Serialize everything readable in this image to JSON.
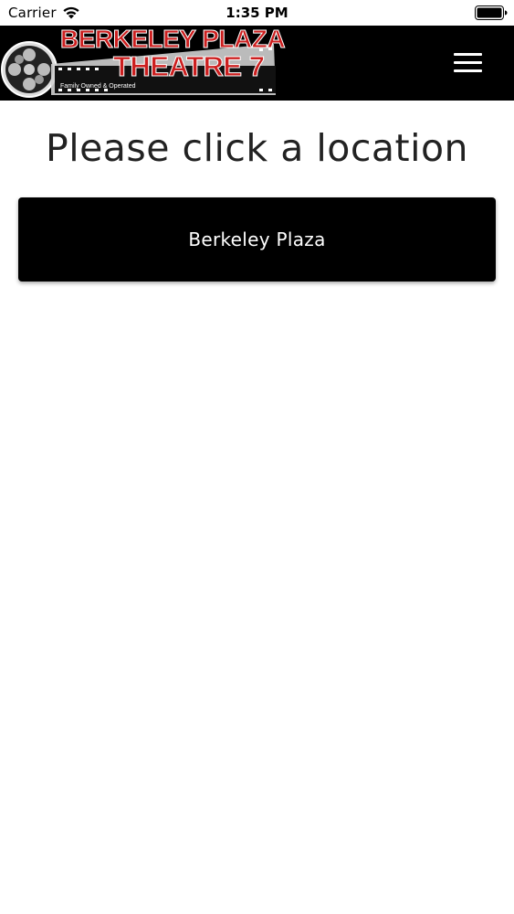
{
  "status_bar": {
    "carrier": "Carrier",
    "time": "1:35 PM",
    "wifi_icon": "wifi-icon",
    "battery_icon": "battery-full-icon"
  },
  "header": {
    "logo": {
      "line1": "BERKELEY PLAZA",
      "line2": "THEATRE 7",
      "tagline": "Family Owned & Operated",
      "title_color": "#cc1f1f"
    },
    "menu_icon": "hamburger-menu-icon",
    "background_color": "#000000"
  },
  "main": {
    "title": "Please click a location",
    "locations": [
      {
        "label": "Berkeley Plaza"
      }
    ],
    "button_color": "#000000"
  }
}
